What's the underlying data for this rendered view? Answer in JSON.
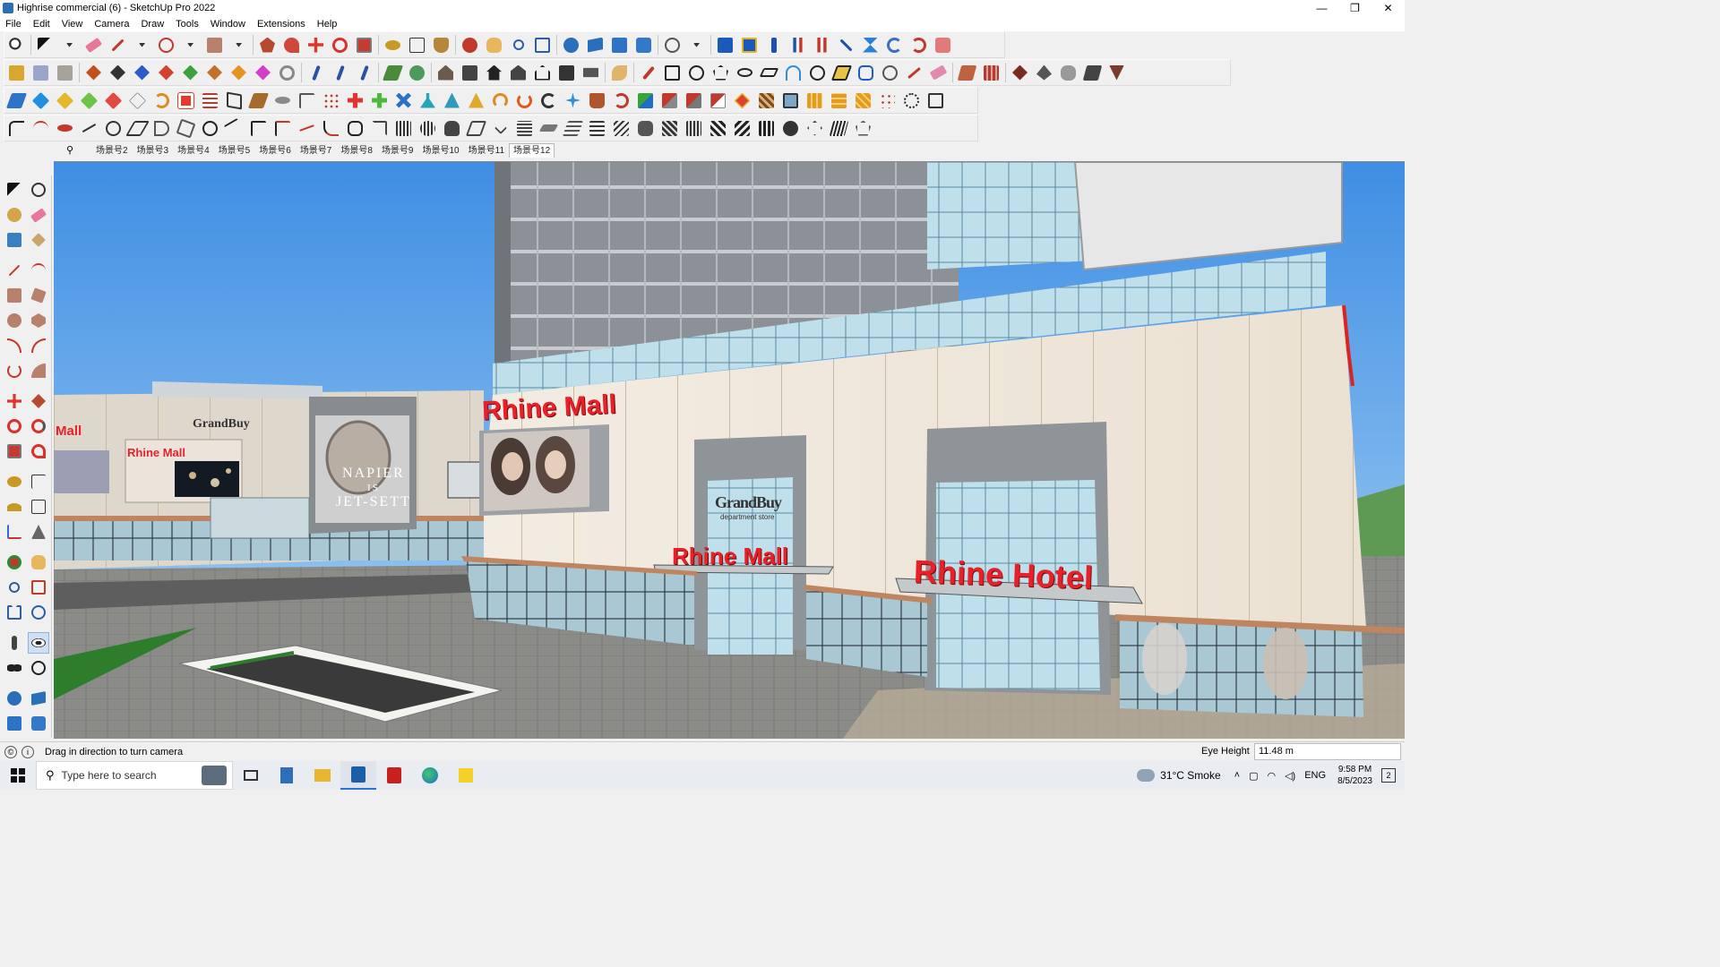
{
  "window": {
    "title": "Highrise commercial (6) - SketchUp Pro 2022",
    "controls": {
      "minimize": "—",
      "restore": "❐",
      "close": "✕"
    }
  },
  "menu": [
    "File",
    "Edit",
    "View",
    "Camera",
    "Draw",
    "Tools",
    "Window",
    "Extensions",
    "Help"
  ],
  "scenes": {
    "search_icon": "⚲",
    "tabs": [
      "场景号2",
      "场景号3",
      "场景号4",
      "场景号5",
      "场景号6",
      "场景号7",
      "场景号8",
      "场景号9",
      "场景号10",
      "场景号11",
      "场景号12"
    ],
    "active": "场景号12"
  },
  "viewport": {
    "signs": {
      "mall_main": "Rhine Mall",
      "mall_entrance": "Rhine Mall",
      "hotel": "Rhine Hotel",
      "mall_left": "Rhine Mall",
      "left_edge": "Mall",
      "store_brand": "GrandBuy",
      "store_brand_sub": "department store",
      "left_brand": "GrandBuy",
      "billboard_text_1": "NAPIER",
      "billboard_text_2": "IS",
      "billboard_text_3": "JET-SETT"
    },
    "colors": {
      "sky": "#4f9ae6",
      "tower": "#8a8f95",
      "podium": "#efe6da",
      "sign_red": "#e8202a",
      "ground": "#7b7b7b",
      "grass": "#2e7d2c"
    }
  },
  "status": {
    "hint": "Drag in direction to turn camera",
    "eye_height_label": "Eye Height",
    "eye_height_value": "11.48 m"
  },
  "taskbar": {
    "search_placeholder": "Type here to search",
    "weather": "31°C  Smoke",
    "lang": "ENG",
    "time": "9:58 PM",
    "date": "8/5/2023",
    "notifications": "2"
  }
}
